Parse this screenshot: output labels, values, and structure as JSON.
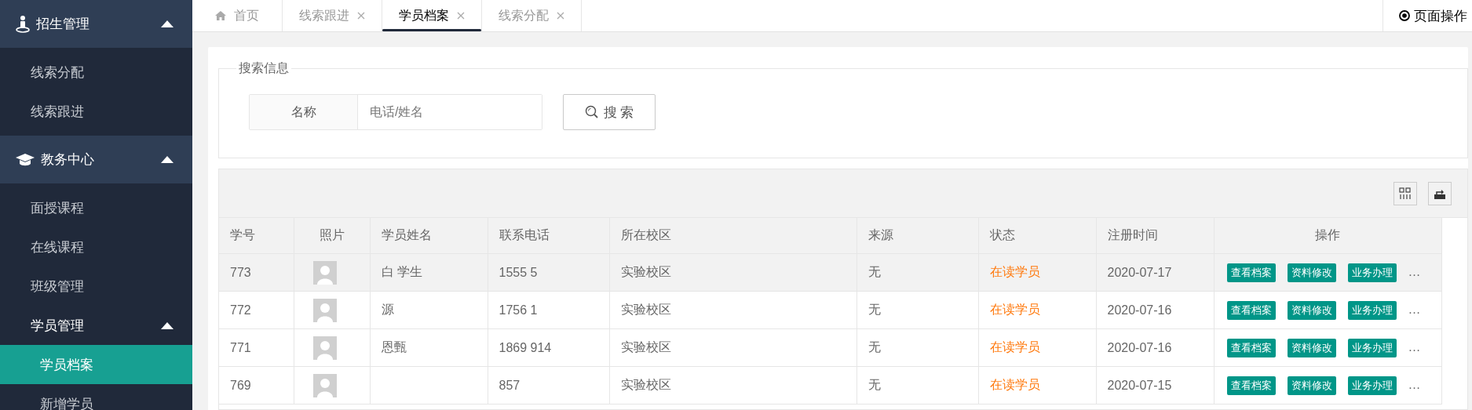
{
  "sidebar": {
    "groups": [
      {
        "title": "招生管理",
        "expanded": true,
        "items": [
          {
            "label": "线索分配",
            "selected": false
          },
          {
            "label": "线索跟进",
            "selected": false
          }
        ]
      },
      {
        "title": "教务中心",
        "expanded": true,
        "items": [
          {
            "label": "面授课程",
            "selected": false
          },
          {
            "label": "在线课程",
            "selected": false
          },
          {
            "label": "班级管理",
            "selected": false
          },
          {
            "label": "学员管理",
            "selected": false,
            "expanded": true,
            "children": [
              {
                "label": "学员档案",
                "selected": true
              },
              {
                "label": "新增学员",
                "selected": false
              }
            ]
          }
        ]
      }
    ]
  },
  "tabs": [
    {
      "label": "首页",
      "kind": "home",
      "selected": false
    },
    {
      "label": "线索跟进",
      "kind": "closable",
      "selected": false
    },
    {
      "label": "学员档案",
      "kind": "closable",
      "selected": true
    },
    {
      "label": "线索分配",
      "kind": "closable",
      "selected": false
    }
  ],
  "page_actions": {
    "label": "页面操作"
  },
  "search": {
    "legend": "搜索信息",
    "field_label": "名称",
    "placeholder": "电话/姓名",
    "button": "搜 索"
  },
  "table": {
    "columns": [
      "学号",
      "照片",
      "学员姓名",
      "联系电话",
      "所在校区",
      "来源",
      "状态",
      "注册时间",
      "操作"
    ],
    "rows": [
      {
        "id": "773",
        "name": "白 学生",
        "phone": "1555 5",
        "campus": "实验校区",
        "source": "无",
        "status": "在读学员",
        "date": "2020-07-17",
        "actions": [
          "查看档案",
          "资料修改",
          "业务办理"
        ],
        "more": "…",
        "highlighted": true
      },
      {
        "id": "772",
        "name": "源",
        "phone": "1756 1",
        "campus": "实验校区",
        "source": "无",
        "status": "在读学员",
        "date": "2020-07-16",
        "actions": [
          "查看档案",
          "资料修改",
          "业务办理"
        ],
        "more": "…",
        "highlighted": false
      },
      {
        "id": "771",
        "name": "恩甄",
        "phone": "1869 914",
        "campus": "实验校区",
        "source": "无",
        "status": "在读学员",
        "date": "2020-07-16",
        "actions": [
          "查看档案",
          "资料修改",
          "业务办理"
        ],
        "more": "…",
        "highlighted": false
      },
      {
        "id": "769",
        "phone": "857",
        "campus": "实验校区",
        "source": "无",
        "status": "在读学员",
        "date": "2020-07-15",
        "actions": [
          "查看档案",
          "资料修改",
          "业务办理"
        ],
        "more": "…",
        "highlighted": false
      }
    ]
  }
}
